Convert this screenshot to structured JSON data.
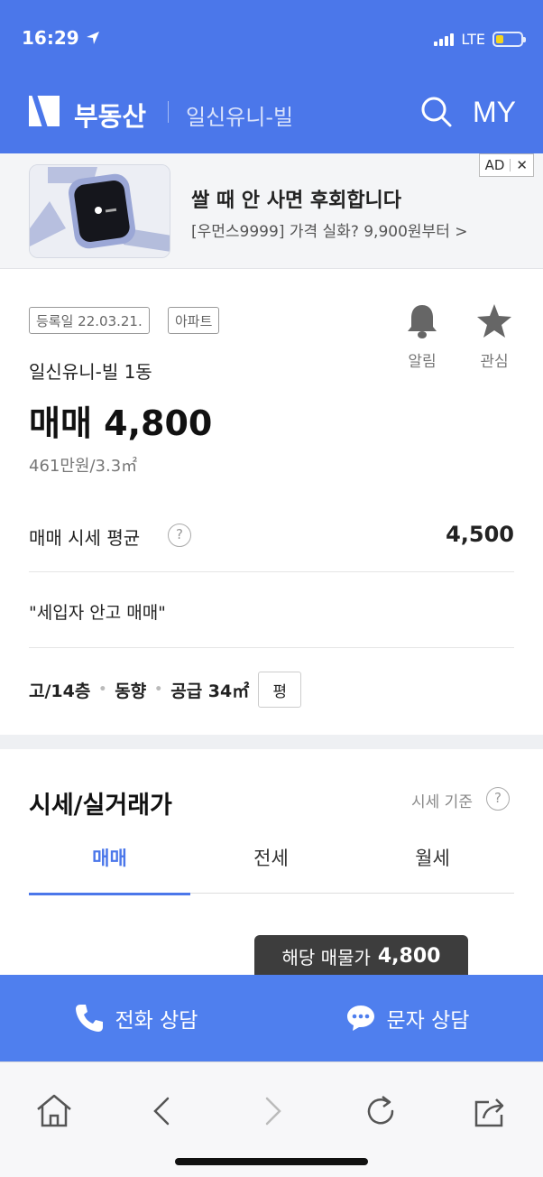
{
  "status_bar": {
    "time": "16:29",
    "network": "LTE",
    "battery_level": 0.3,
    "battery_color": "#f5d51e"
  },
  "header": {
    "brand": "부동산",
    "subtitle": "일신유니-빌",
    "my_label": "MY",
    "background": "#4b77ea"
  },
  "ad": {
    "title": "쌀 때 안 사면 후회합니다",
    "subtitle": "[우먼스9999] 가격 실화? 9,900원부터 >",
    "badge": "AD",
    "close_label": "✕"
  },
  "listing": {
    "reg_date_tag": "등록일 22.03.21.",
    "type_tag": "아파트",
    "alarm_label": "알림",
    "fav_label": "관심",
    "complex_name": "일신유니-빌 1동",
    "price": "매매 4,800",
    "unit_price": "461만원/3.3㎡",
    "avg_label": "매매 시세 평균",
    "avg_value": "4,500",
    "description": "\"세입자 안고 매매\"",
    "floor": "고/14층",
    "direction": "동향",
    "area": "공급 34㎡",
    "pyeong_label": "평"
  },
  "price_section": {
    "title": "시세/실거래가",
    "basis_label": "시세 기준",
    "tabs": [
      "매매",
      "전세",
      "월세"
    ],
    "active_tab": 0,
    "tooltip_prefix": "해당 매물가",
    "tooltip_value": "4,800"
  },
  "contact": {
    "call_label": "전화 상담",
    "sms_label": "문자 상담"
  },
  "browser_nav": {
    "icons": [
      "home-icon",
      "back-icon",
      "forward-icon",
      "reload-icon",
      "share-icon"
    ]
  },
  "colors": {
    "accent": "#4b77ea",
    "contact_bar": "#4f7fee"
  }
}
